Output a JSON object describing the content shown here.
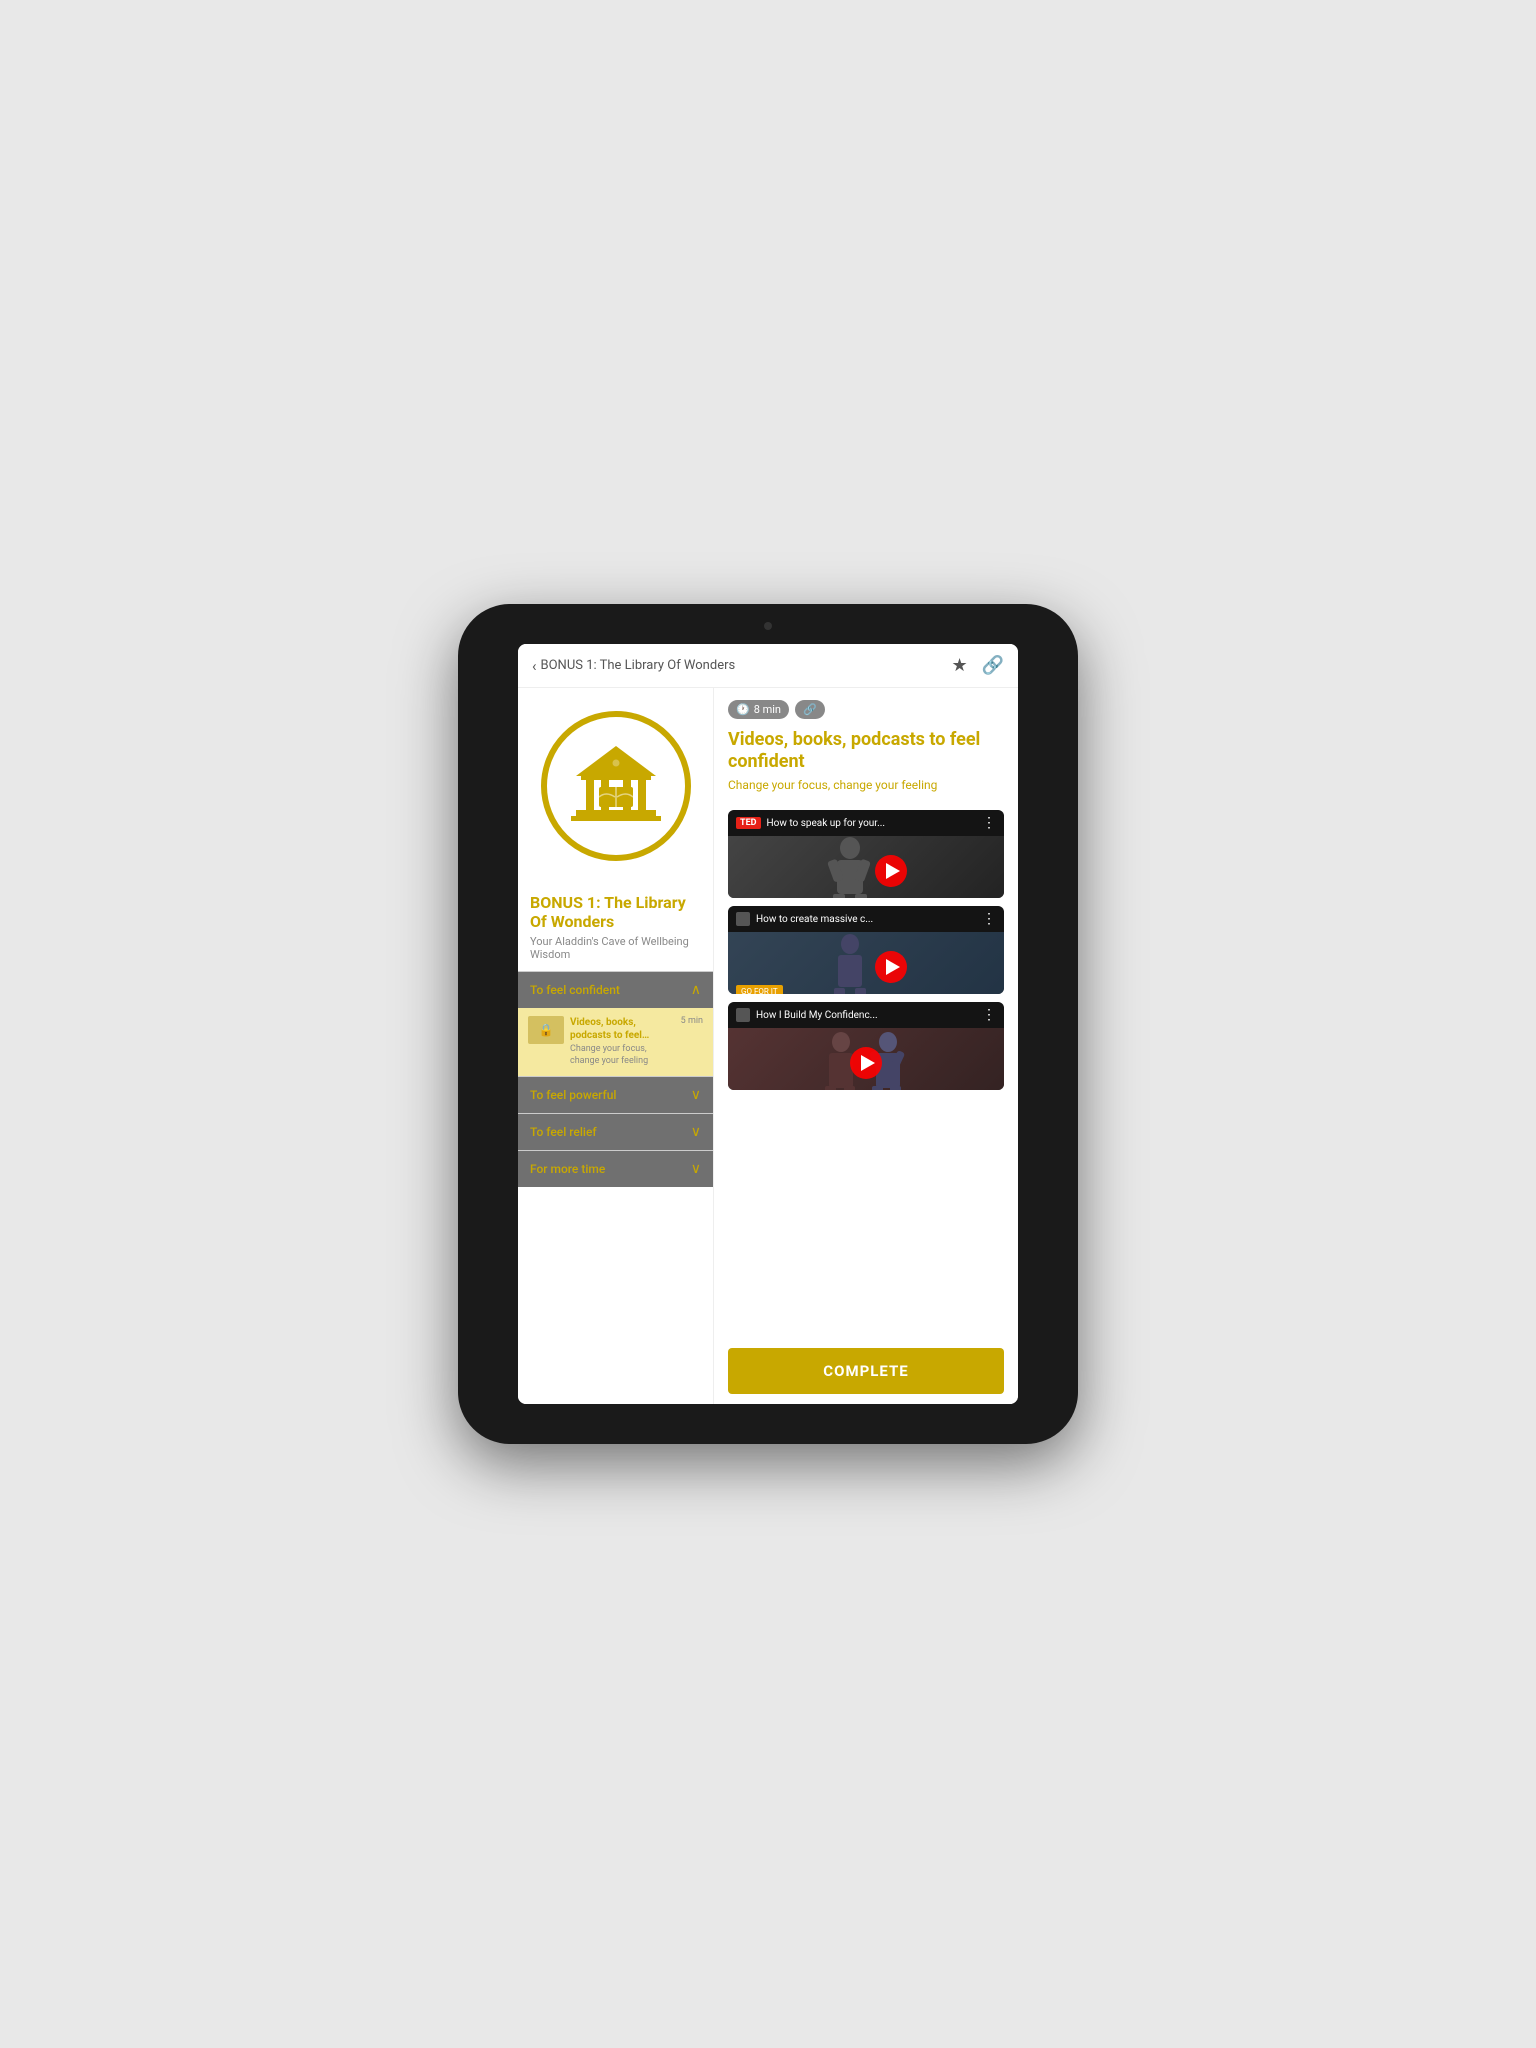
{
  "nav": {
    "back_label": "BONUS 1: The Library Of Wonders",
    "star_icon": "★",
    "link_icon": "🔗"
  },
  "left_panel": {
    "course_title": "BONUS 1: The Library Of Wonders",
    "course_subtitle": "Your Aladdin's Cave of Wellbeing Wisdom",
    "accordion_items": [
      {
        "label": "To feel confident",
        "expanded": true,
        "content": {
          "thumb_label": "🔒",
          "title": "Videos, books, podcasts to feel confident",
          "subtitle": "Change your focus, change your feeling",
          "time": "5 min"
        }
      },
      {
        "label": "To feel powerful",
        "expanded": false
      },
      {
        "label": "To feel relief",
        "expanded": false
      },
      {
        "label": "For more time",
        "expanded": false
      }
    ]
  },
  "right_panel": {
    "tags": [
      {
        "icon": "🕐",
        "label": "8 min"
      },
      {
        "icon": "🔗",
        "label": ""
      }
    ],
    "title": "Videos, books, podcasts to feel confident",
    "subtitle": "Change your focus, change your feeling",
    "videos": [
      {
        "source": "TED",
        "title": "How to speak up for your...",
        "bg_class": "video-bg-color-1"
      },
      {
        "source": "📺",
        "title": "How to create massive c...",
        "bg_class": "video-bg-color-2"
      },
      {
        "source": "📺",
        "title": "How I Build My Confidenc...",
        "bg_class": "video-bg-color-3"
      }
    ],
    "complete_button": "COMPLETE"
  }
}
